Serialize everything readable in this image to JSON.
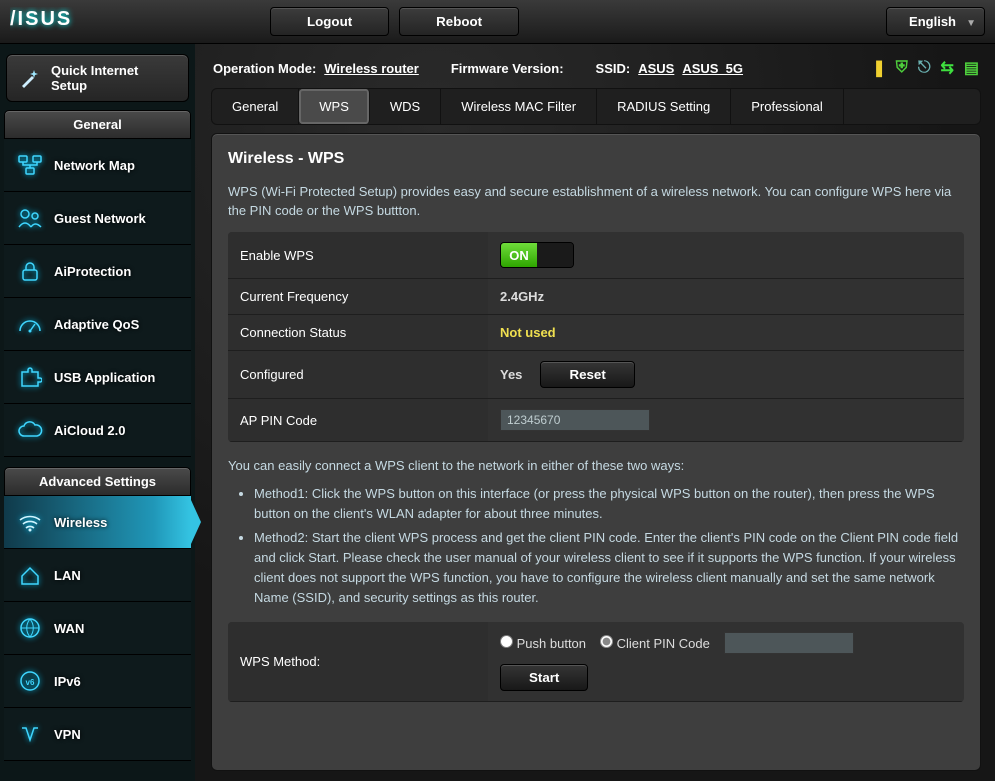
{
  "top": {
    "logo_text": "ASUS",
    "logout": "Logout",
    "reboot": "Reboot",
    "language": "English"
  },
  "info": {
    "op_mode_label": "Operation Mode:",
    "op_mode_value": "Wireless  router",
    "fw_label": "Firmware Version:",
    "ssid_label": "SSID:",
    "ssid1": "ASUS",
    "ssid2": "ASUS_5G"
  },
  "sidebar": {
    "qis": "Quick Internet Setup",
    "general_title": "General",
    "general": [
      {
        "label": "Network Map"
      },
      {
        "label": "Guest Network"
      },
      {
        "label": "AiProtection"
      },
      {
        "label": "Adaptive QoS"
      },
      {
        "label": "USB Application"
      },
      {
        "label": "AiCloud 2.0"
      }
    ],
    "adv_title": "Advanced Settings",
    "adv": [
      {
        "label": "Wireless"
      },
      {
        "label": "LAN"
      },
      {
        "label": "WAN"
      },
      {
        "label": "IPv6"
      },
      {
        "label": "VPN"
      }
    ]
  },
  "tabs": [
    "General",
    "WPS",
    "WDS",
    "Wireless MAC Filter",
    "RADIUS Setting",
    "Professional"
  ],
  "page": {
    "title": "Wireless - WPS",
    "intro": "WPS (Wi-Fi Protected Setup) provides easy and secure establishment of a wireless network. You can configure WPS here via the PIN code or the WPS buttton.",
    "rows": {
      "enable_label": "Enable WPS",
      "enable_value": "ON",
      "freq_label": "Current Frequency",
      "freq_value": "2.4GHz",
      "conn_label": "Connection Status",
      "conn_value": "Not used",
      "conf_label": "Configured",
      "conf_value": "Yes",
      "reset": "Reset",
      "pin_label": "AP PIN Code",
      "pin_value": "12345670"
    },
    "methods_intro": "You can easily connect a WPS client to the network in either of these two ways:",
    "method1": "Method1: Click the WPS button on this interface (or press the physical WPS button on the router), then press the WPS button on the client's WLAN adapter for about three minutes.",
    "method2": "Method2: Start the client WPS process and get the client PIN code. Enter the client's PIN code on the Client PIN code field and click Start. Please check the user manual of your wireless client to see if it supports the WPS function. If your wireless client does not support the WPS function, you have to configure the wireless client manually and set the same network Name (SSID), and security settings as this router.",
    "wps_method_label": "WPS Method:",
    "push_btn": "Push button",
    "client_pin": "Client PIN Code",
    "start": "Start"
  }
}
